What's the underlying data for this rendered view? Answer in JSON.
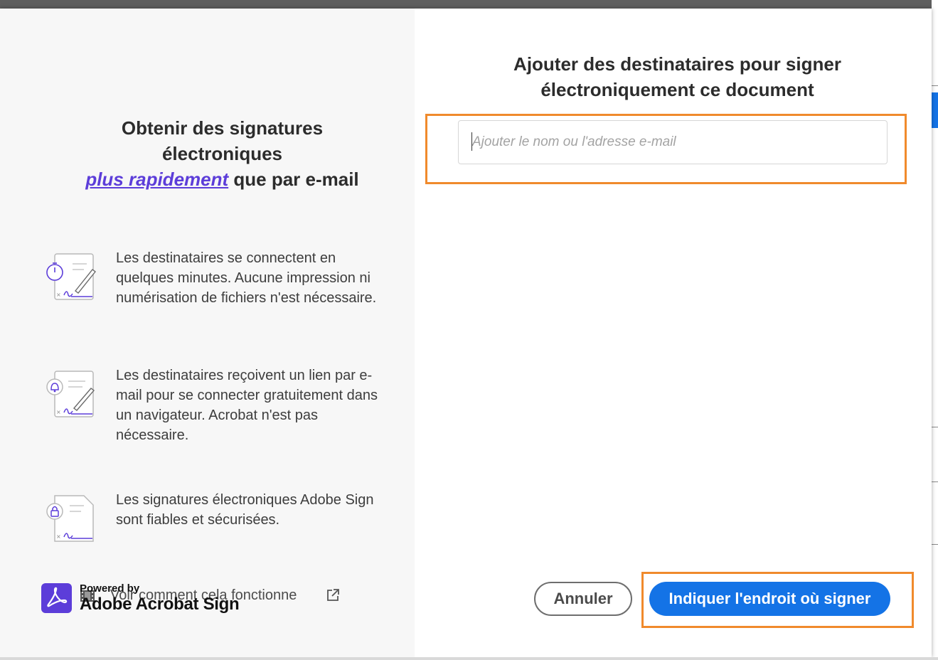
{
  "left_panel": {
    "heading_line1": "Obtenir des signatures",
    "heading_line2": "électroniques",
    "heading_emphasis": "plus rapidement",
    "heading_suffix": " que par e-mail",
    "features": [
      {
        "icon": "clock-document-pen-icon",
        "text": "Les destinataires se connectent en quelques minutes. Aucune impression ni numérisation de fichiers n'est nécessaire."
      },
      {
        "icon": "bell-document-pen-icon",
        "text": "Les destinataires reçoivent un lien par e-mail pour se connecter gratuitement dans un navigateur. Acrobat n'est pas nécessaire."
      },
      {
        "icon": "lock-document-icon",
        "text": "Les signatures électroniques Adobe Sign sont fiables et sécurisées."
      }
    ],
    "how_link": "Voir comment cela fonctionne",
    "powered_by": "Powered by",
    "product_name": "Adobe Acrobat Sign"
  },
  "right_panel": {
    "title_line1": "Ajouter des destinataires pour signer",
    "title_line2": "électroniquement ce document",
    "recipient_input": {
      "value": "",
      "placeholder": "Ajouter le nom ou l'adresse e-mail"
    }
  },
  "footer": {
    "cancel_label": "Annuler",
    "primary_label": "Indiquer l'endroit où signer"
  },
  "colors": {
    "accent_blue": "#1473e6",
    "emphasis_purple": "#5c3dd9",
    "highlight_orange": "#f08a2c"
  }
}
